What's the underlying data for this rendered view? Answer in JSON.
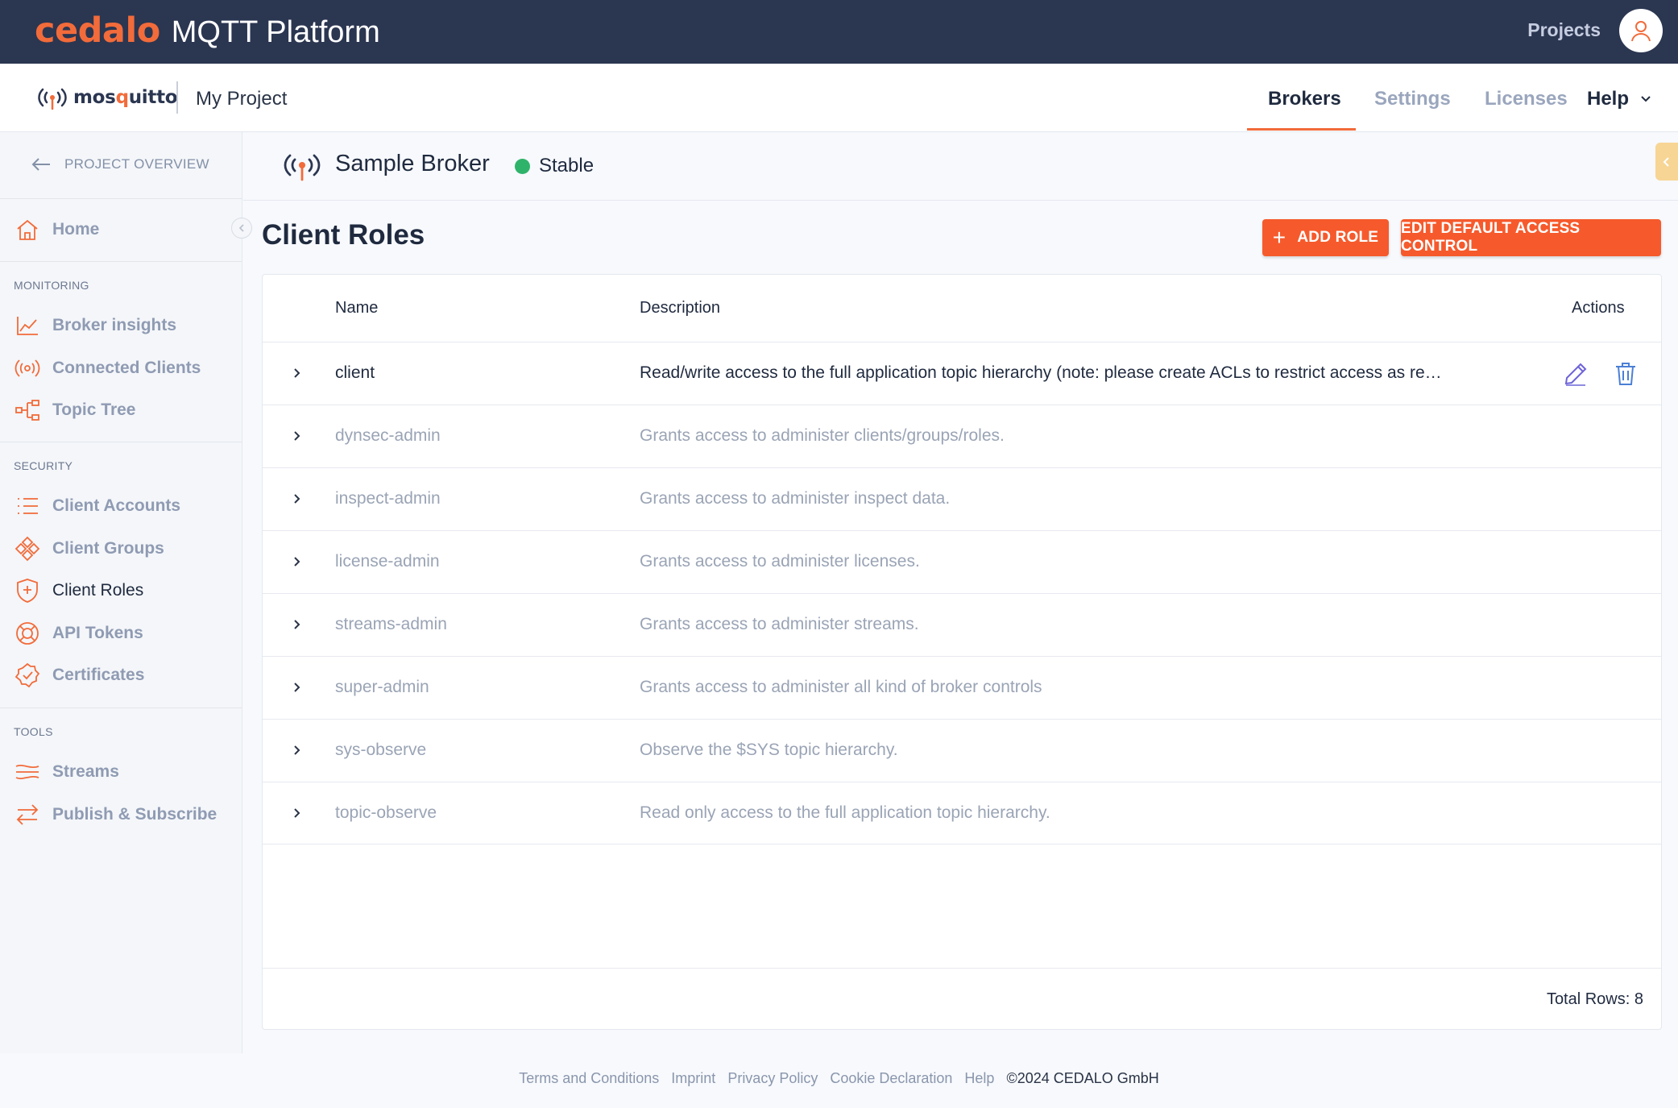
{
  "header": {
    "brand": "cedalo",
    "product": "MQTT Platform",
    "projects_label": "Projects"
  },
  "subheader": {
    "logo_text_prefix": "mos",
    "logo_text_accent": "q",
    "logo_text_suffix": "uitto",
    "project_name": "My Project",
    "tabs": [
      {
        "label": "Brokers",
        "active": true
      },
      {
        "label": "Settings",
        "active": false
      },
      {
        "label": "Licenses",
        "active": false
      },
      {
        "label": "Help",
        "active": false
      }
    ]
  },
  "sidebar": {
    "back_label": "PROJECT OVERVIEW",
    "home": "Home",
    "sections": {
      "monitoring": "MONITORING",
      "security": "SECURITY",
      "tools": "TOOLS"
    },
    "monitoring_items": [
      "Broker insights",
      "Connected Clients",
      "Topic Tree"
    ],
    "security_items": [
      "Client Accounts",
      "Client Groups",
      "Client Roles",
      "API Tokens",
      "Certificates"
    ],
    "tools_items": [
      "Streams",
      "Publish & Subscribe"
    ],
    "active_item": "Client Roles"
  },
  "broker": {
    "name": "Sample Broker",
    "status": "Stable",
    "status_color": "#2fb36b"
  },
  "page": {
    "title": "Client Roles",
    "add_role_label": "ADD ROLE",
    "edit_default_label": "EDIT DEFAULT ACCESS CONTROL"
  },
  "table": {
    "columns": [
      "Name",
      "Description",
      "Actions"
    ],
    "rows": [
      {
        "name": "client",
        "description": "Read/write access to the full application topic hierarchy (note: please create ACLs to restrict access as required by y…"
      },
      {
        "name": "dynsec-admin",
        "description": "Grants access to administer clients/groups/roles."
      },
      {
        "name": "inspect-admin",
        "description": "Grants access to administer inspect data."
      },
      {
        "name": "license-admin",
        "description": "Grants access to administer licenses."
      },
      {
        "name": "streams-admin",
        "description": "Grants access to administer streams."
      },
      {
        "name": "super-admin",
        "description": "Grants access to administer all kind of broker controls"
      },
      {
        "name": "sys-observe",
        "description": "Observe the $SYS topic hierarchy."
      },
      {
        "name": "topic-observe",
        "description": "Read only access to the full application topic hierarchy."
      }
    ],
    "total_rows_label": "Total Rows: 8"
  },
  "footer": {
    "links": [
      "Terms and Conditions",
      "Imprint",
      "Privacy Policy",
      "Cookie Declaration",
      "Help"
    ],
    "copyright": "©2024 CEDALO GmbH"
  },
  "colors": {
    "accent": "#f26b3a",
    "button": "#f65a2c",
    "header_bg": "#2b3651",
    "edit_icon": "#6d63d8",
    "delete_icon": "#4b7fd6"
  }
}
